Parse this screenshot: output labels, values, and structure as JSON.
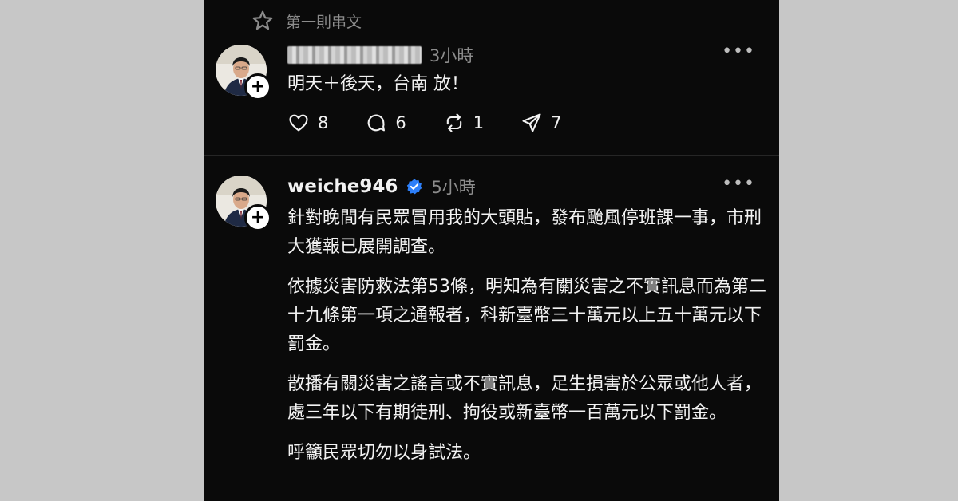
{
  "thread_header": {
    "label": "第一則串文"
  },
  "post1": {
    "time": "3小時",
    "text": "明天＋後天，台南 放！",
    "likes": "8",
    "replies": "6",
    "reposts": "1",
    "shares": "7",
    "more": "•••"
  },
  "post2": {
    "username": "weiche946",
    "time": "5小時",
    "more": "•••",
    "paragraphs": [
      "針對晚間有民眾冒用我的大頭貼，發布颱風停班課一事，市刑大獲報已展開調查。",
      "依據災害防救法第53條，明知為有關災害之不實訊息而為第二十九條第一項之通報者，科新臺幣三十萬元以上五十萬元以下罰金。",
      "散播有關災害之謠言或不實訊息，足生損害於公眾或他人者，處三年以下有期徒刑、拘役或新臺幣一百萬元以下罰金。",
      "呼籲民眾切勿以身試法。"
    ]
  },
  "colors": {
    "background": "#0a0a0a",
    "text": "#f2f2f2",
    "muted": "#8c8c8c",
    "verified": "#2d7ff9"
  }
}
